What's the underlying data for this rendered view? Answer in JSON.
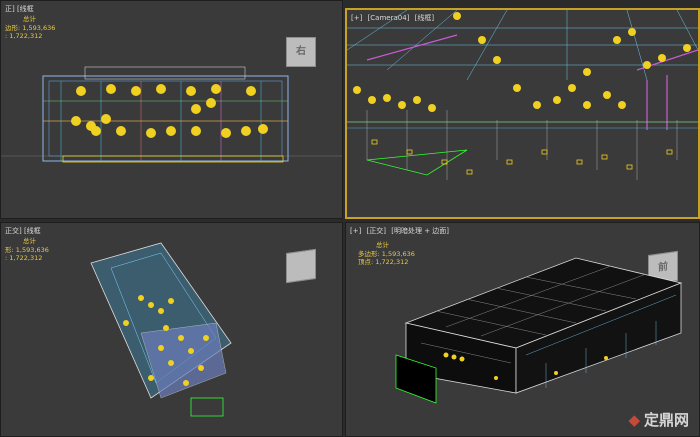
{
  "viewports": {
    "top_left": {
      "label": "正] [线框",
      "stats": {
        "title": "总计",
        "polys_label": "边形:",
        "polys": "1,593,636",
        "verts_label": ":",
        "verts": "1,722,312"
      },
      "cube_text": "右"
    },
    "top_right": {
      "label_a": "[+]",
      "label_b": "[Camera04]",
      "label_c": "[线框]"
    },
    "bottom_left": {
      "label": "正交] [线框",
      "stats": {
        "title": "总计",
        "polys_label": "形:",
        "polys": "1,593,636",
        "verts_label": ":",
        "verts": "1,722,312"
      }
    },
    "bottom_right": {
      "label_a": "[+]",
      "label_b": "[正交]",
      "label_c": "[明暗处理 + 边面]",
      "stats": {
        "title": "总计",
        "polys_label": "多边形:",
        "polys": "1,593,636",
        "verts_label": "顶点:",
        "verts": "1,722,312"
      },
      "cube_text": "前"
    }
  },
  "watermark": {
    "logo": "◆",
    "text": "定鼎网"
  },
  "colors": {
    "accent_yellow": "#e8c94a",
    "active_border": "#c8a227",
    "viewport_bg": "#3a3a3a"
  }
}
